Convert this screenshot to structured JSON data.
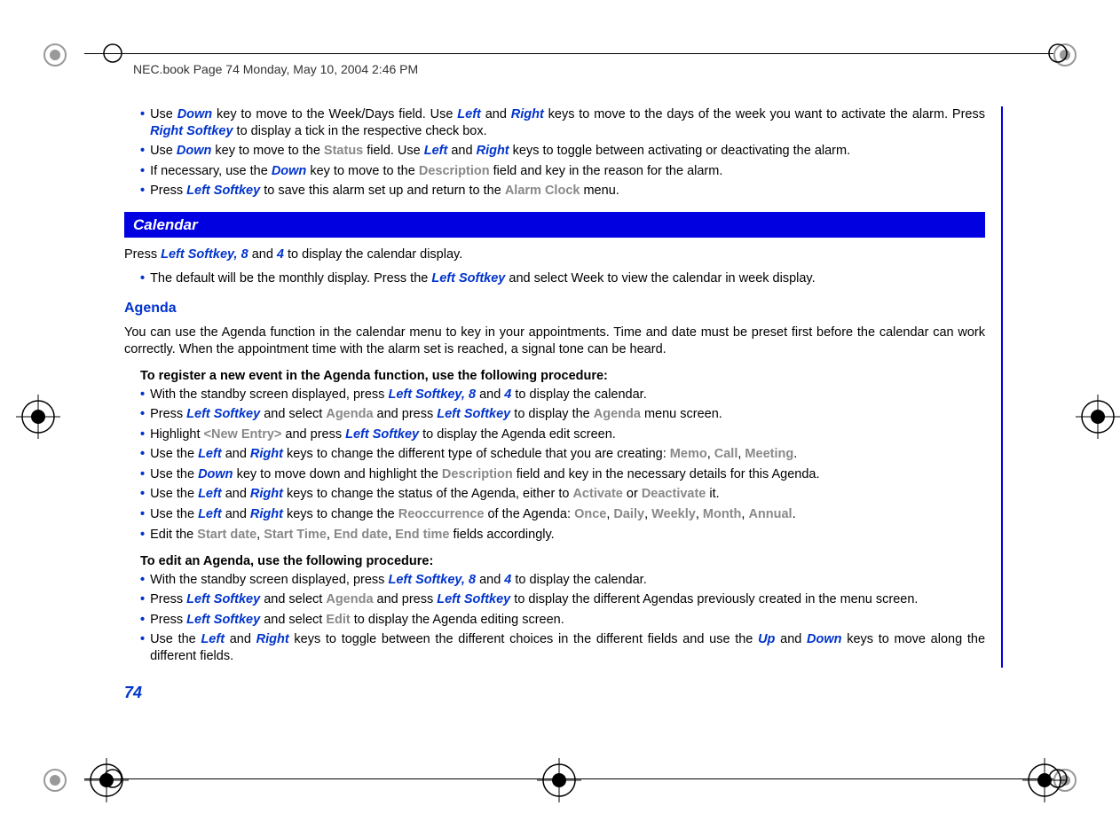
{
  "header": "NEC.book  Page 74  Monday, May 10, 2004  2:46 PM",
  "page_number": "74",
  "section_banner": "Calendar",
  "sub_heading": "Agenda",
  "top_bullets": [
    {
      "parts": [
        {
          "t": "Use ",
          "c": ""
        },
        {
          "t": "Down",
          "c": "key"
        },
        {
          "t": " key to move to the Week/Days field. Use ",
          "c": ""
        },
        {
          "t": "Left",
          "c": "key"
        },
        {
          "t": " and ",
          "c": ""
        },
        {
          "t": "Right",
          "c": "key"
        },
        {
          "t": " keys to move to the days of the week you want to activate the alarm. Press ",
          "c": ""
        },
        {
          "t": "Right Softkey",
          "c": "key"
        },
        {
          "t": " to display a tick in the respective check box.",
          "c": ""
        }
      ]
    },
    {
      "parts": [
        {
          "t": "Use ",
          "c": ""
        },
        {
          "t": "Down",
          "c": "key"
        },
        {
          "t": " key to move to the ",
          "c": ""
        },
        {
          "t": "Status",
          "c": "menu"
        },
        {
          "t": " field. Use ",
          "c": ""
        },
        {
          "t": "Left",
          "c": "key"
        },
        {
          "t": " and ",
          "c": ""
        },
        {
          "t": "Right",
          "c": "key"
        },
        {
          "t": " keys to toggle between activating or deactivating the alarm.",
          "c": ""
        }
      ]
    },
    {
      "parts": [
        {
          "t": "If necessary, use the ",
          "c": ""
        },
        {
          "t": "Down",
          "c": "key"
        },
        {
          "t": " key to move to the ",
          "c": ""
        },
        {
          "t": "Description",
          "c": "menu"
        },
        {
          "t": " field and key in the reason for the alarm.",
          "c": ""
        }
      ]
    },
    {
      "parts": [
        {
          "t": "Press ",
          "c": ""
        },
        {
          "t": "Left Softkey",
          "c": "key"
        },
        {
          "t": " to save this alarm set up and return to the ",
          "c": ""
        },
        {
          "t": "Alarm Clock",
          "c": "menu"
        },
        {
          "t": " menu.",
          "c": ""
        }
      ]
    }
  ],
  "calendar_intro_parts": [
    {
      "t": "Press ",
      "c": ""
    },
    {
      "t": "Left Softkey, 8",
      "c": "key"
    },
    {
      "t": " and ",
      "c": ""
    },
    {
      "t": "4",
      "c": "key"
    },
    {
      "t": " to display the calendar display.",
      "c": ""
    }
  ],
  "calendar_bullet": {
    "parts": [
      {
        "t": "The default will be the monthly display. Press the ",
        "c": ""
      },
      {
        "t": "Left Softkey",
        "c": "key"
      },
      {
        "t": " and select Week to view the calendar in week display.",
        "c": ""
      }
    ]
  },
  "agenda_para": "You can use the Agenda function in the calendar menu to key in your appointments. Time and date must be preset first before the calendar can work correctly. When the appointment time with the alarm set is reached, a signal tone can be heard.",
  "register_intro": "To register a new event in the Agenda function, use the following procedure:",
  "register_bullets": [
    {
      "parts": [
        {
          "t": "With the standby screen displayed, press ",
          "c": ""
        },
        {
          "t": "Left Softkey, 8",
          "c": "key"
        },
        {
          "t": " and ",
          "c": ""
        },
        {
          "t": "4",
          "c": "key"
        },
        {
          "t": " to display the calendar.",
          "c": ""
        }
      ]
    },
    {
      "parts": [
        {
          "t": "Press ",
          "c": ""
        },
        {
          "t": "Left Softkey",
          "c": "key"
        },
        {
          "t": " and select ",
          "c": ""
        },
        {
          "t": "Agenda",
          "c": "menu"
        },
        {
          "t": " and press ",
          "c": ""
        },
        {
          "t": "Left Softkey",
          "c": "key"
        },
        {
          "t": " to display the ",
          "c": ""
        },
        {
          "t": "Agenda",
          "c": "menu"
        },
        {
          "t": " menu screen.",
          "c": ""
        }
      ]
    },
    {
      "parts": [
        {
          "t": "Highlight ",
          "c": ""
        },
        {
          "t": "<New Entry>",
          "c": "menu"
        },
        {
          "t": " and press ",
          "c": ""
        },
        {
          "t": "Left Softkey",
          "c": "key"
        },
        {
          "t": " to display the Agenda edit screen.",
          "c": ""
        }
      ]
    },
    {
      "parts": [
        {
          "t": "Use the ",
          "c": ""
        },
        {
          "t": "Left",
          "c": "key"
        },
        {
          "t": " and ",
          "c": ""
        },
        {
          "t": "Right",
          "c": "key"
        },
        {
          "t": " keys to change the different type of schedule that you are creating: ",
          "c": ""
        },
        {
          "t": "Memo",
          "c": "menu"
        },
        {
          "t": ", ",
          "c": ""
        },
        {
          "t": "Call",
          "c": "menu"
        },
        {
          "t": ", ",
          "c": ""
        },
        {
          "t": "Meeting",
          "c": "menu"
        },
        {
          "t": ".",
          "c": ""
        }
      ]
    },
    {
      "parts": [
        {
          "t": "Use the ",
          "c": ""
        },
        {
          "t": "Down",
          "c": "key"
        },
        {
          "t": " key to move down and highlight the ",
          "c": ""
        },
        {
          "t": "Description",
          "c": "menu"
        },
        {
          "t": " field and key in the necessary details for this Agenda.",
          "c": ""
        }
      ]
    },
    {
      "parts": [
        {
          "t": "Use the ",
          "c": ""
        },
        {
          "t": "Left",
          "c": "key"
        },
        {
          "t": " and ",
          "c": ""
        },
        {
          "t": "Right",
          "c": "key"
        },
        {
          "t": " keys to change the status of the Agenda, either to ",
          "c": ""
        },
        {
          "t": "Activate",
          "c": "menu"
        },
        {
          "t": " or ",
          "c": ""
        },
        {
          "t": "Deactivate",
          "c": "menu"
        },
        {
          "t": " it.",
          "c": ""
        }
      ]
    },
    {
      "parts": [
        {
          "t": "Use the ",
          "c": ""
        },
        {
          "t": "Left",
          "c": "key"
        },
        {
          "t": " and ",
          "c": ""
        },
        {
          "t": "Right",
          "c": "key"
        },
        {
          "t": " keys to change the ",
          "c": ""
        },
        {
          "t": "Reoccurrence",
          "c": "menu"
        },
        {
          "t": " of the Agenda: ",
          "c": ""
        },
        {
          "t": "Once",
          "c": "menu"
        },
        {
          "t": ", ",
          "c": ""
        },
        {
          "t": "Daily",
          "c": "menu"
        },
        {
          "t": ", ",
          "c": ""
        },
        {
          "t": "Weekly",
          "c": "menu"
        },
        {
          "t": ", ",
          "c": ""
        },
        {
          "t": "Month",
          "c": "menu"
        },
        {
          "t": ", ",
          "c": ""
        },
        {
          "t": "Annual",
          "c": "menu"
        },
        {
          "t": ".",
          "c": ""
        }
      ]
    },
    {
      "parts": [
        {
          "t": "Edit the ",
          "c": ""
        },
        {
          "t": "Start date",
          "c": "menu"
        },
        {
          "t": ", ",
          "c": ""
        },
        {
          "t": "Start Time",
          "c": "menu"
        },
        {
          "t": ", ",
          "c": ""
        },
        {
          "t": "End date",
          "c": "menu"
        },
        {
          "t": ", ",
          "c": ""
        },
        {
          "t": "End time",
          "c": "menu"
        },
        {
          "t": " fields accordingly.",
          "c": ""
        }
      ]
    }
  ],
  "edit_intro": "To edit an Agenda, use the following procedure:",
  "edit_bullets": [
    {
      "parts": [
        {
          "t": "With the standby screen displayed, press ",
          "c": ""
        },
        {
          "t": "Left Softkey, 8",
          "c": "key"
        },
        {
          "t": " and ",
          "c": ""
        },
        {
          "t": "4",
          "c": "key"
        },
        {
          "t": " to display the calendar.",
          "c": ""
        }
      ]
    },
    {
      "parts": [
        {
          "t": "Press ",
          "c": ""
        },
        {
          "t": "Left Softkey",
          "c": "key"
        },
        {
          "t": " and select ",
          "c": ""
        },
        {
          "t": "Agenda",
          "c": "menu"
        },
        {
          "t": " and press ",
          "c": ""
        },
        {
          "t": "Left Softkey",
          "c": "key"
        },
        {
          "t": " to display the different Agendas previously created in the menu screen.",
          "c": ""
        }
      ]
    },
    {
      "parts": [
        {
          "t": "Press ",
          "c": ""
        },
        {
          "t": "Left Softkey",
          "c": "key"
        },
        {
          "t": " and select ",
          "c": ""
        },
        {
          "t": "Edit",
          "c": "menu"
        },
        {
          "t": " to display the Agenda editing screen.",
          "c": ""
        }
      ]
    },
    {
      "parts": [
        {
          "t": "Use the ",
          "c": ""
        },
        {
          "t": "Left",
          "c": "key"
        },
        {
          "t": " and ",
          "c": ""
        },
        {
          "t": "Right",
          "c": "key"
        },
        {
          "t": " keys to toggle between the different choices in the different fields and use the ",
          "c": ""
        },
        {
          "t": "Up",
          "c": "key"
        },
        {
          "t": " and ",
          "c": ""
        },
        {
          "t": "Down",
          "c": "key"
        },
        {
          "t": " keys to move along the different fields.",
          "c": ""
        }
      ]
    }
  ]
}
